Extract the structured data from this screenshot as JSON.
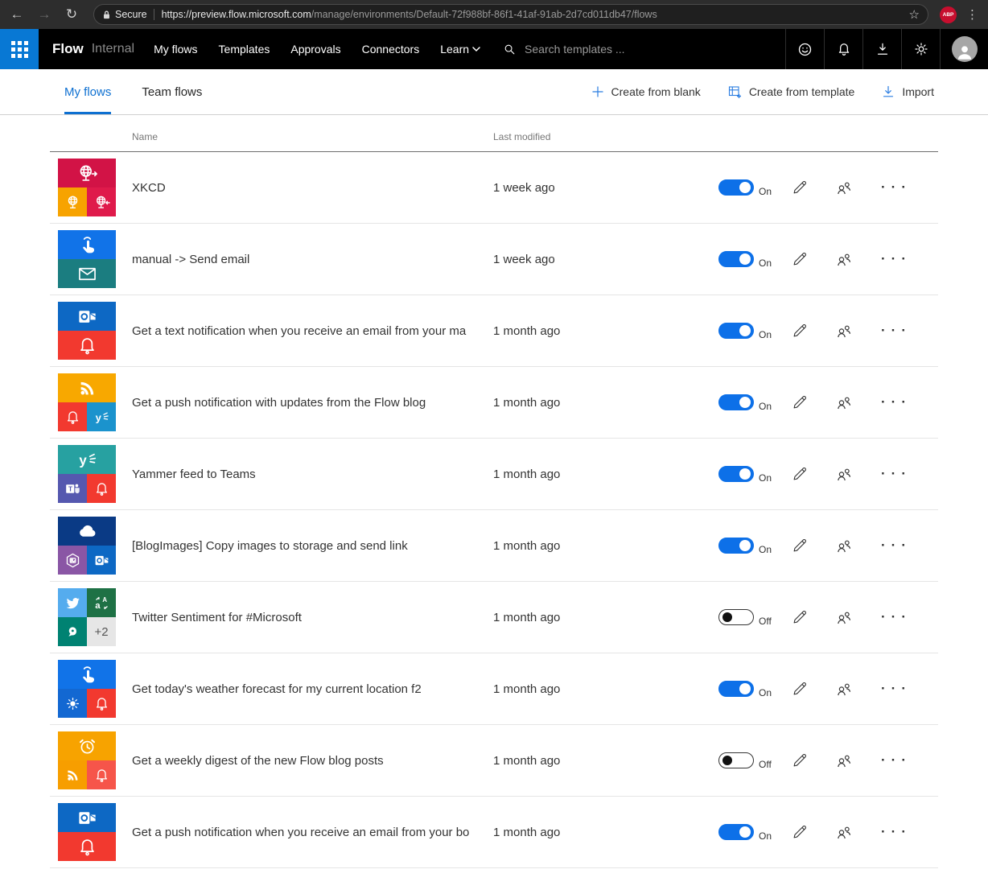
{
  "browser": {
    "secure_label": "Secure",
    "url_main": "https://preview.flow.microsoft.com",
    "url_path": "/manage/environments/Default-72f988bf-86f1-41af-91ab-2d7cd011db47/flows",
    "adblock_badge": "ABP"
  },
  "appbar": {
    "brand": "Flow",
    "environment": "Internal",
    "nav": [
      "My flows",
      "Templates",
      "Approvals",
      "Connectors",
      "Learn"
    ],
    "search_placeholder": "Search templates ..."
  },
  "tabs": [
    {
      "label": "My flows",
      "active": true
    },
    {
      "label": "Team flows",
      "active": false
    }
  ],
  "actions": [
    {
      "label": "Create from blank",
      "icon": "plus-icon"
    },
    {
      "label": "Create from template",
      "icon": "template-icon"
    },
    {
      "label": "Import",
      "icon": "import-icon"
    }
  ],
  "colors": {
    "accent_blue": "#0e70d1",
    "toggle_on": "#0d70e8"
  },
  "table": {
    "columns": [
      "Name",
      "Last modified"
    ],
    "rows": [
      {
        "name": "XKCD",
        "modified": "1 week ago",
        "enabled": true,
        "toggle_label": "On",
        "tile": {
          "layout": "top2",
          "cells": [
            {
              "color": "#d21346",
              "icon": "globe-arrow-right"
            },
            {
              "color": "#f7a300",
              "icon": "globe"
            },
            {
              "color": "#df1a4b",
              "icon": "globe-arrow-left"
            }
          ]
        }
      },
      {
        "name": "manual -> Send email",
        "modified": "1 week ago",
        "enabled": true,
        "toggle_label": "On",
        "tile": {
          "layout": "halves",
          "cells": [
            {
              "color": "#1173e8",
              "icon": "touch"
            },
            {
              "color": "#1b7d80",
              "icon": "envelope"
            }
          ]
        }
      },
      {
        "name": "Get a text notification when you receive an email from your ma",
        "modified": "1 month ago",
        "enabled": true,
        "toggle_label": "On",
        "tile": {
          "layout": "halves",
          "cells": [
            {
              "color": "#0d68c4",
              "icon": "outlook"
            },
            {
              "color": "#f2392f",
              "icon": "bell"
            }
          ]
        }
      },
      {
        "name": "Get a push notification with updates from the Flow blog",
        "modified": "1 month ago",
        "enabled": true,
        "toggle_label": "On",
        "tile": {
          "layout": "top2",
          "cells": [
            {
              "color": "#f8a800",
              "icon": "rss"
            },
            {
              "color": "#f2392f",
              "icon": "bell"
            },
            {
              "color": "#1b93cd",
              "icon": "yammer"
            }
          ]
        }
      },
      {
        "name": "Yammer feed to Teams",
        "modified": "1 month ago",
        "enabled": true,
        "toggle_label": "On",
        "tile": {
          "layout": "top2",
          "cells": [
            {
              "color": "#27a1a1",
              "icon": "yammer"
            },
            {
              "color": "#5558af",
              "icon": "teams"
            },
            {
              "color": "#f2392f",
              "icon": "bell"
            }
          ]
        }
      },
      {
        "name": "[BlogImages] Copy images to storage and send link",
        "modified": "1 month ago",
        "enabled": true,
        "toggle_label": "On",
        "tile": {
          "layout": "top2",
          "cells": [
            {
              "color": "#0a3a85",
              "icon": "cloud"
            },
            {
              "color": "#8a56a5",
              "icon": "hexagon-image"
            },
            {
              "color": "#0d68c4",
              "icon": "outlook"
            }
          ]
        }
      },
      {
        "name": "Twitter Sentiment for #Microsoft",
        "modified": "1 month ago",
        "enabled": false,
        "toggle_label": "Off",
        "tile": {
          "layout": "quad",
          "cells": [
            {
              "color": "#55acee",
              "icon": "twitter"
            },
            {
              "color": "#1e7145",
              "icon": "translator"
            },
            {
              "color": "#008272",
              "icon": "speech-analytics"
            },
            {
              "color": "#e6e6e6",
              "icon": "plus-two",
              "label": "+2"
            }
          ]
        }
      },
      {
        "name": "Get today's weather forecast for my current location f2",
        "modified": "1 month ago",
        "enabled": true,
        "toggle_label": "On",
        "tile": {
          "layout": "top2",
          "cells": [
            {
              "color": "#1173e8",
              "icon": "touch"
            },
            {
              "color": "#1368d2",
              "icon": "sun"
            },
            {
              "color": "#f2392f",
              "icon": "bell"
            }
          ]
        }
      },
      {
        "name": "Get a weekly digest of the new Flow blog posts",
        "modified": "1 month ago",
        "enabled": false,
        "toggle_label": "Off",
        "tile": {
          "layout": "top2",
          "cells": [
            {
              "color": "#f7a300",
              "icon": "alarm-clock"
            },
            {
              "color": "#f79e00",
              "icon": "rss"
            },
            {
              "color": "#f6554a",
              "icon": "bell"
            }
          ]
        }
      },
      {
        "name": "Get a push notification when you receive an email from your bo",
        "modified": "1 month ago",
        "enabled": true,
        "toggle_label": "On",
        "tile": {
          "layout": "halves",
          "cells": [
            {
              "color": "#0d68c4",
              "icon": "outlook"
            },
            {
              "color": "#f2392f",
              "icon": "bell"
            }
          ]
        }
      }
    ]
  }
}
